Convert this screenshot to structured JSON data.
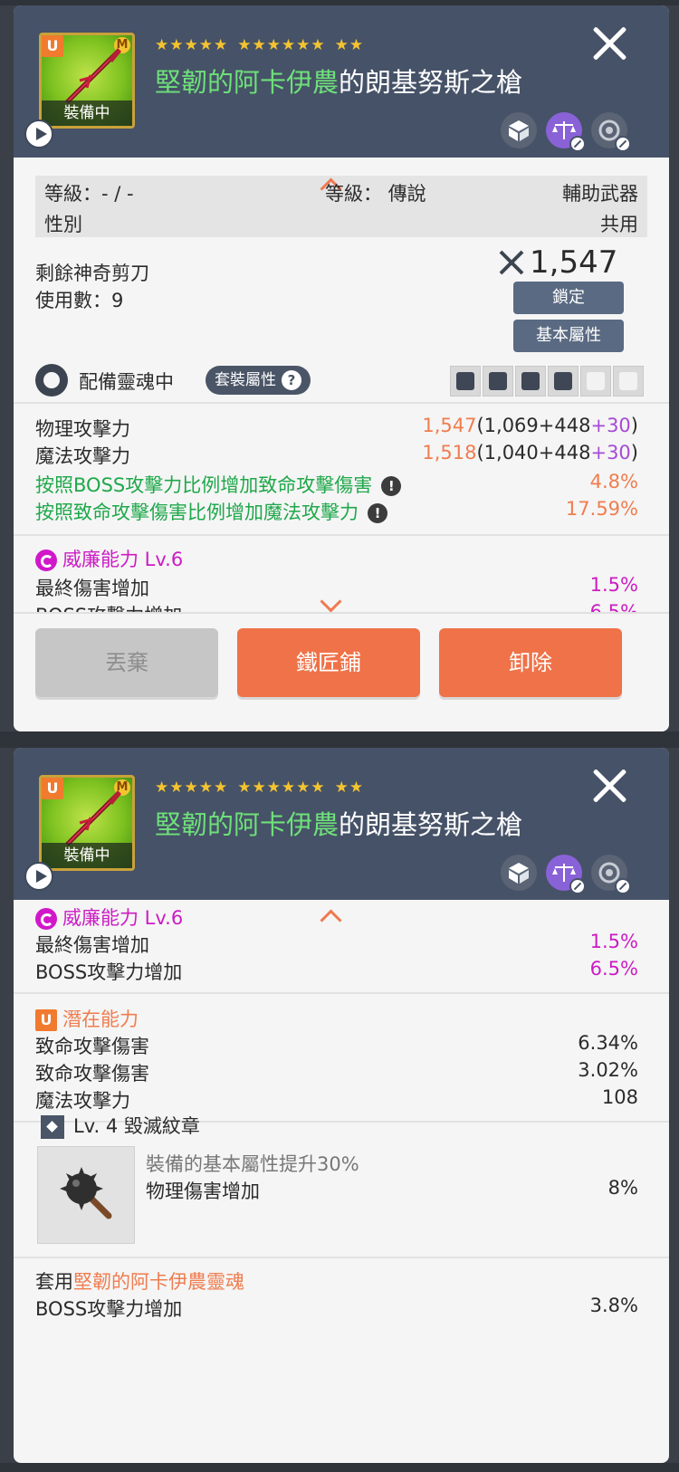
{
  "colors": {
    "header": "#465267",
    "accent_orange": "#ef7248",
    "green_text": "#1fa84a",
    "magenta": "#cc1cc4",
    "purple": "#a54bd6"
  },
  "item": {
    "rank_badge": "U",
    "mastery_badge": "M",
    "equipped_label": "裝備中",
    "stars_group1": "★★★★★",
    "stars_group2": "★★★★★★",
    "stars_group3": "★★",
    "title_prefix": "堅韌的阿卡伊農",
    "title_suffix": "的朗基努斯之槍"
  },
  "info": {
    "level_label": "等級：- / -",
    "gender_label": "性別",
    "grade_label": "等級： 傳說",
    "type_label": "輔助武器",
    "gender_value": "共用"
  },
  "scissors": {
    "label": "剩餘神奇剪刀",
    "uses": "使用數：9",
    "power": "1,547",
    "lock_button": "鎖定",
    "base_stats_button": "基本屬性"
  },
  "soul": {
    "label": "配備靈魂中",
    "set_button": "套裝屬性"
  },
  "stats": [
    {
      "name": "物理攻擊力",
      "total": "1,547",
      "open": "(1,069+448",
      "bonus": "+30",
      "close": ")"
    },
    {
      "name": "魔法攻擊力",
      "total": "1,518",
      "open": "(1,040+448",
      "bonus": "+30",
      "close": ")"
    }
  ],
  "special": [
    {
      "name": "按照BOSS攻擊力比例增加致命攻擊傷害",
      "value": "4.8%"
    },
    {
      "name": "按照致命攻擊傷害比例增加魔法攻擊力",
      "value": "17.59%"
    }
  ],
  "prestige": {
    "title": "威廉能力 Lv.6",
    "lines": [
      {
        "name": "最終傷害增加",
        "value": "1.5%"
      },
      {
        "name": "BOSS攻擊力增加",
        "value": "6.5%"
      }
    ]
  },
  "potential": {
    "badge": "U",
    "title": "潛在能力",
    "lines": [
      {
        "name": "致命攻擊傷害",
        "value": "6.34%"
      },
      {
        "name": "致命攻擊傷害",
        "value": "3.02%"
      },
      {
        "name": "魔法攻擊力",
        "value": "108"
      }
    ]
  },
  "emblem": {
    "title": "Lv. 4 毀滅紋章",
    "desc": "裝備的基本屬性提升30%",
    "stat_name": "物理傷害增加",
    "stat_value": "8%"
  },
  "soul_applied": {
    "prefix": "套用",
    "name": "堅韌的阿卡伊農靈魂",
    "stat_name": "BOSS攻擊力增加",
    "stat_value": "3.8%"
  },
  "footer": {
    "discard": "丟棄",
    "blacksmith": "鐵匠鋪",
    "unequip": "卸除"
  }
}
